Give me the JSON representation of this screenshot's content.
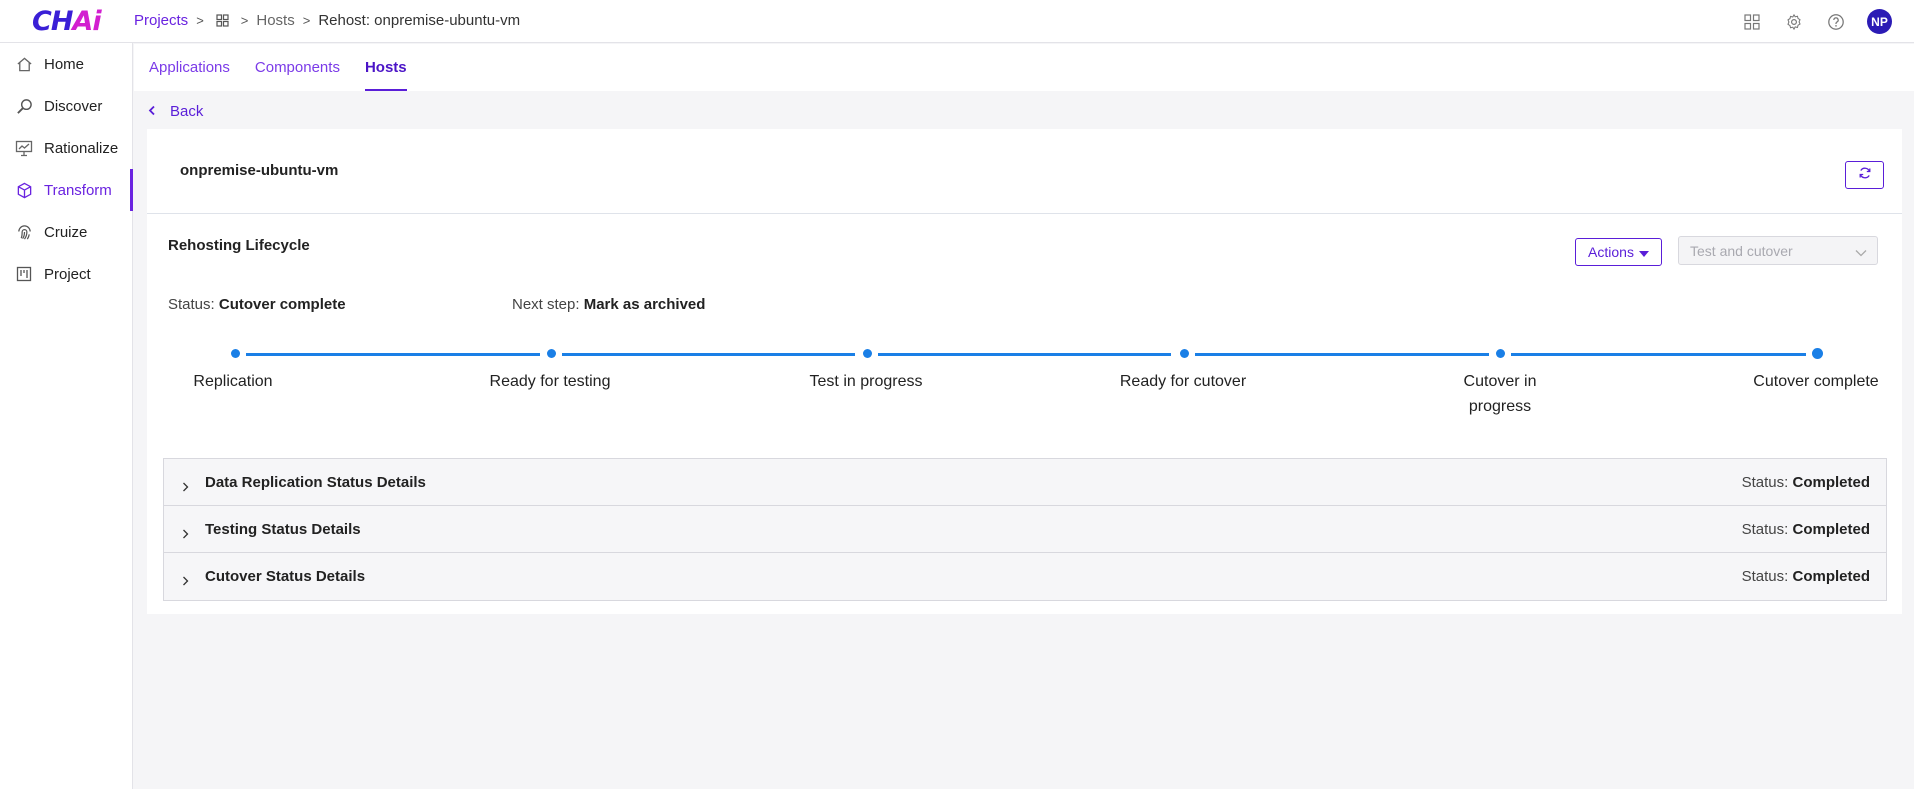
{
  "app": {
    "logo_main": "CH",
    "logo_accent": "Ai"
  },
  "breadcrumb": {
    "projects": "Projects",
    "hosts": "Hosts",
    "current": "Rehost: onpremise-ubuntu-vm"
  },
  "user": {
    "initials": "NP"
  },
  "sidebar": {
    "items": [
      {
        "label": "Home",
        "icon": "home-icon"
      },
      {
        "label": "Discover",
        "icon": "discover-icon"
      },
      {
        "label": "Rationalize",
        "icon": "rationalize-icon"
      },
      {
        "label": "Transform",
        "icon": "cube-icon",
        "active": true
      },
      {
        "label": "Cruize",
        "icon": "fingerprint-icon"
      },
      {
        "label": "Project",
        "icon": "board-icon"
      }
    ]
  },
  "tabs": [
    {
      "label": "Applications"
    },
    {
      "label": "Components"
    },
    {
      "label": "Hosts",
      "active": true
    }
  ],
  "back_label": "Back",
  "host": {
    "name": "onpremise-ubuntu-vm"
  },
  "lifecycle": {
    "title": "Rehosting Lifecycle",
    "actions_label": "Actions",
    "select_value": "Test and cutover",
    "status_label": "Status:",
    "status_value": "Cutover complete",
    "next_label": "Next step:",
    "next_value": "Mark as archived",
    "steps": [
      {
        "label": "Replication"
      },
      {
        "label": "Ready for testing"
      },
      {
        "label": "Test in progress"
      },
      {
        "label": "Ready for cutover"
      },
      {
        "label_line1": "Cutover in",
        "label_line2": "progress"
      },
      {
        "label": "Cutover complete"
      }
    ]
  },
  "details": [
    {
      "title": "Data Replication Status Details",
      "status_label": "Status:",
      "status_value": "Completed"
    },
    {
      "title": "Testing Status Details",
      "status_label": "Status:",
      "status_value": "Completed"
    },
    {
      "title": "Cutover Status Details",
      "status_label": "Status:",
      "status_value": "Completed"
    }
  ],
  "colors": {
    "brand": "#5a1ed8",
    "progress": "#1a7fe6",
    "avatar": "#2b1bb5"
  }
}
